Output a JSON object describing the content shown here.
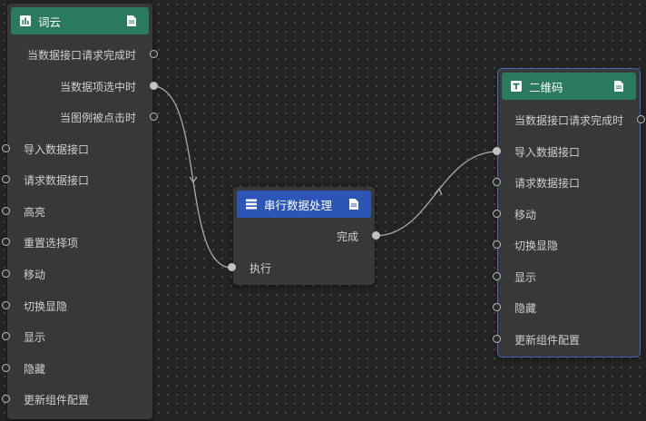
{
  "colors": {
    "header_green": "#2a7a5e",
    "header_blue": "#2b56b8",
    "node_bg": "#383838",
    "edge": "#a8a8a8"
  },
  "nodes": {
    "wordcloud": {
      "title": "词云",
      "icon": "bar-chart-icon",
      "outputs": [
        "当数据接口请求完成时",
        "当数据项选中时",
        "当图例被点击时"
      ],
      "inputs": [
        "导入数据接口",
        "请求数据接口",
        "高亮",
        "重置选择项",
        "移动",
        "切换显隐",
        "显示",
        "隐藏",
        "更新组件配置"
      ]
    },
    "serial": {
      "title": "串行数据处理",
      "icon": "list-icon",
      "outputs": [
        "完成"
      ],
      "inputs": [
        "执行"
      ]
    },
    "qrcode": {
      "title": "二维码",
      "icon": "text-icon",
      "outputs": [
        "当数据接口请求完成时"
      ],
      "inputs": [
        "导入数据接口",
        "请求数据接口",
        "移动",
        "切换显隐",
        "显示",
        "隐藏",
        "更新组件配置"
      ]
    }
  }
}
